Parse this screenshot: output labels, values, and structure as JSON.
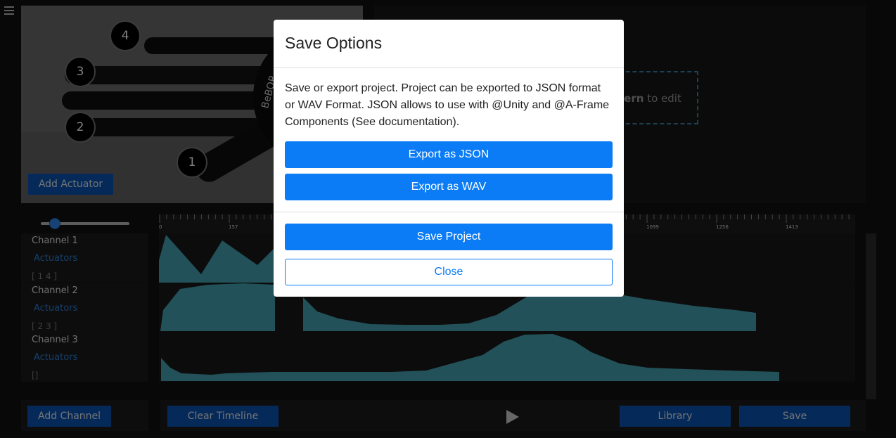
{
  "menu": {
    "icon": "hamburger-icon"
  },
  "actuators": {
    "markers": [
      "4",
      "3",
      "2",
      "1"
    ],
    "add_button": "Add Actuator"
  },
  "editor": {
    "hint_bold": "tern",
    "hint_rest": " to edit"
  },
  "timeline": {
    "zoom_level": 0.1,
    "ticks": [
      "0",
      "157",
      "1099",
      "1256",
      "1413"
    ],
    "channels": [
      {
        "name": "Channel 1",
        "link": "Actuators",
        "list": "[ 1 4 ]"
      },
      {
        "name": "Channel 2",
        "link": "Actuators",
        "list": "[ 2 3 ]"
      },
      {
        "name": "Channel 3",
        "link": "Actuators",
        "list": "[]"
      }
    ]
  },
  "toolbar": {
    "add_channel": "Add Channel",
    "clear_timeline": "Clear Timeline",
    "play_icon": "play-icon",
    "library": "Library",
    "save": "Save"
  },
  "modal": {
    "title": "Save Options",
    "body": "Save or export project. Project can be exported to JSON format or WAV Format. JSON allows to use with @Unity and @A-Frame Components (See documentation).",
    "export_json": "Export as JSON",
    "export_wav": "Export as WAV",
    "save_project": "Save Project",
    "close": "Close"
  },
  "colors": {
    "waveform": "#45a3b5",
    "primary": "#0b7cf5",
    "primary_dark": "#0a55b5",
    "link": "#2a7fd6"
  }
}
